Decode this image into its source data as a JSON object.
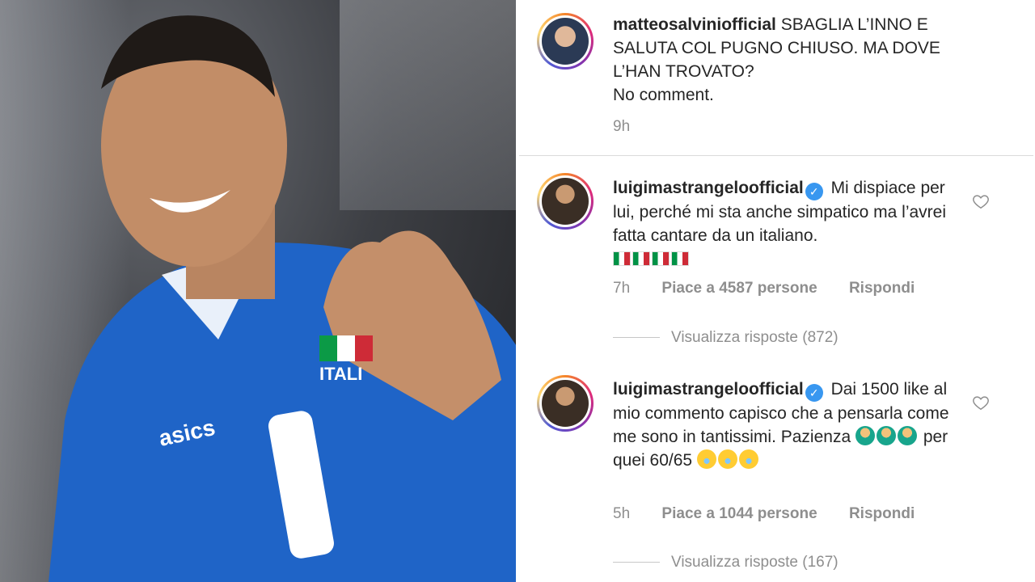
{
  "post": {
    "username": "matteosalviniofficial",
    "caption": "SBAGLIA L’INNO E SALUTA COL PUGNO CHIUSO. MA DOVE L’HAN TROVATO?",
    "caption2": "No comment.",
    "time": "9h"
  },
  "comments": [
    {
      "username": "luigimastrangeloofficial",
      "text": "Mi dispiace per lui, perché mi sta anche simpatico ma l’avrei fatta cantare da un italiano.",
      "time": "7h",
      "likes": "Piace a 4587 persone",
      "reply": "Rispondi",
      "view_replies": "Visualizza risposte (872)"
    },
    {
      "username": "luigimastrangeloofficial",
      "text_a": "Dai 1500 like al mio commento capisco che a pensarla come me sono in tantissimi. Pazienza",
      "text_b": "per quei 60/65",
      "time": "5h",
      "likes": "Piace a 1044 persone",
      "reply": "Rispondi",
      "view_replies": "Visualizza risposte (167)"
    }
  ],
  "icons": [
    "verified-badge-icon",
    "heart-icon",
    "italian-flag-emoji",
    "shrug-emoji",
    "laughing-emoji"
  ],
  "colors": {
    "verified": "#3897f0",
    "muted": "#8e8e8e",
    "text": "#262626"
  }
}
